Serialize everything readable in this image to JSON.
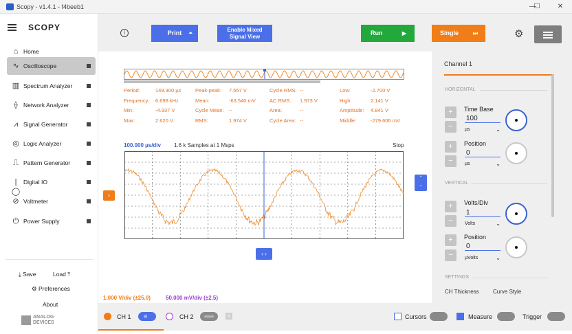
{
  "window": {
    "title": "Scopy - v1.4.1 - f4beeb1",
    "controls": [
      "—",
      "☐",
      "✕"
    ]
  },
  "sidebar": {
    "logo": "SCOPY",
    "home": "Home",
    "items": [
      {
        "label": "Oscilloscope",
        "icon": "oscilloscope-icon",
        "active": true
      },
      {
        "label": "Spectrum Analyzer",
        "icon": "spectrum-icon"
      },
      {
        "label": "Network Analyzer",
        "icon": "network-icon"
      },
      {
        "label": "Signal Generator",
        "icon": "signal-generator-icon"
      },
      {
        "label": "Logic Analyzer",
        "icon": "logic-analyzer-icon"
      },
      {
        "label": "Pattern Generator",
        "icon": "pattern-generator-icon"
      },
      {
        "label": "Digital IO",
        "icon": "digital-io-icon"
      },
      {
        "label": "Voltmeter",
        "icon": "voltmeter-icon"
      },
      {
        "label": "Power Supply",
        "icon": "power-supply-icon"
      }
    ],
    "save": "Save",
    "load": "Load",
    "preferences": "Preferences",
    "about": "About",
    "brand_line1": "ANALOG",
    "brand_line2": "DEVICES"
  },
  "toolbar": {
    "print": "Print",
    "mixed_signal_line1": "Enable Mixed",
    "mixed_signal_line2": "Signal View",
    "run": "Run",
    "single": "Single",
    "colors": {
      "blue": "#4a6fe8",
      "green": "#22a83b",
      "orange": "#f07d17"
    }
  },
  "measurements": {
    "col1": [
      {
        "label": "Period:",
        "value": "149.300 µs"
      },
      {
        "label": "Frequency:",
        "value": "6.698 kHz"
      },
      {
        "label": "Min:",
        "value": "-4.937 V"
      },
      {
        "label": "Max:",
        "value": "2.620 V"
      }
    ],
    "col2": [
      {
        "label": "Peak-peak:",
        "value": "7.557 V"
      },
      {
        "label": "Mean:",
        "value": "-63.540 mV"
      },
      {
        "label": "Cycle Mean:",
        "value": "--"
      },
      {
        "label": "RMS:",
        "value": "1.974 V"
      }
    ],
    "col3": [
      {
        "label": "Cycle RMS:",
        "value": "--"
      },
      {
        "label": "AC RMS:",
        "value": "1.973 V"
      },
      {
        "label": "Area:",
        "value": "--"
      },
      {
        "label": "Cycle Area:",
        "value": "--"
      }
    ],
    "col4": [
      {
        "label": "Low:",
        "value": "-2.700 V"
      },
      {
        "label": "High:",
        "value": "2.141 V"
      },
      {
        "label": "Amplitude:",
        "value": "4.841 V"
      },
      {
        "label": "Middle:",
        "value": "-279.606 mV"
      }
    ]
  },
  "plot": {
    "time_div": "100.000 µs/div",
    "samples": "1.6 k Samples at 1 Msps",
    "status": "Stop",
    "ch1_div": "1.000 V/div (±25.0)",
    "ch2_div": "50.000 mV/div (±2.5)",
    "trace_color": "#f08a2a"
  },
  "channels": {
    "ch1": "CH 1",
    "ch2": "CH 2",
    "add": "+",
    "cursors": "Cursors",
    "measure": "Measure",
    "trigger": "Trigger"
  },
  "right_panel": {
    "title": "Channel 1",
    "horizontal": "HORIZONTAL",
    "vertical": "VERTICAL",
    "settings": "SETTINGS",
    "time_base_label": "Time Base",
    "time_base_value": "100",
    "time_base_unit": "µs",
    "position_label": "Position",
    "h_position_value": "0",
    "h_position_unit": "µs",
    "volts_div_label": "Volts/Div",
    "volts_div_value": "1",
    "volts_div_unit": "Volts",
    "v_position_value": "0",
    "v_position_unit": "µVolts",
    "ch_thickness": "CH Thickness",
    "curve_style": "Curve Style"
  }
}
